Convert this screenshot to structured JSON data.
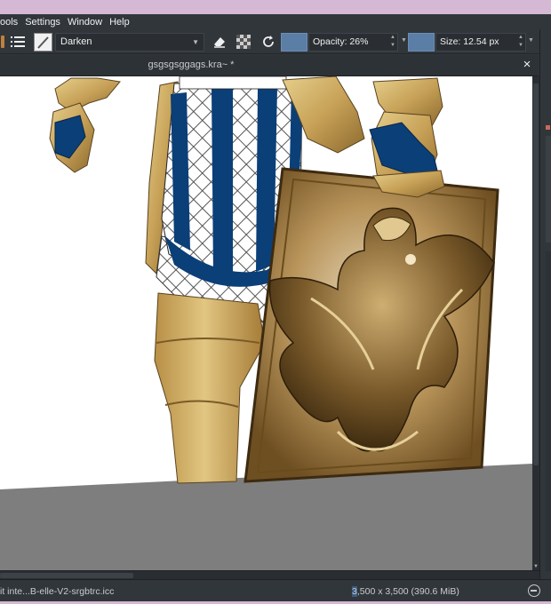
{
  "menubar": {
    "items": [
      "ools",
      "Settings",
      "Window",
      "Help"
    ]
  },
  "toolbar": {
    "blend_mode": "Darken",
    "opacity_label": "Opacity: 26%",
    "size_label": "Size: 12.54 px",
    "swatch_color": "#5b7ea6"
  },
  "document": {
    "tab_title": "gsgsgsggags.kra~ *",
    "close_icon": "×"
  },
  "statusbar": {
    "profile": "it inte...B-elle-V2-srgbtrc.icc",
    "dims_highlight": "3",
    "dims_rest": ",500 x 3,500 (390.6 MiB)"
  },
  "colors": {
    "panel_bg": "#31363b",
    "canvas_bg": "#7e7e7e",
    "armor_gold": "#c8a45c",
    "cloth_blue": "#0b3f78"
  }
}
